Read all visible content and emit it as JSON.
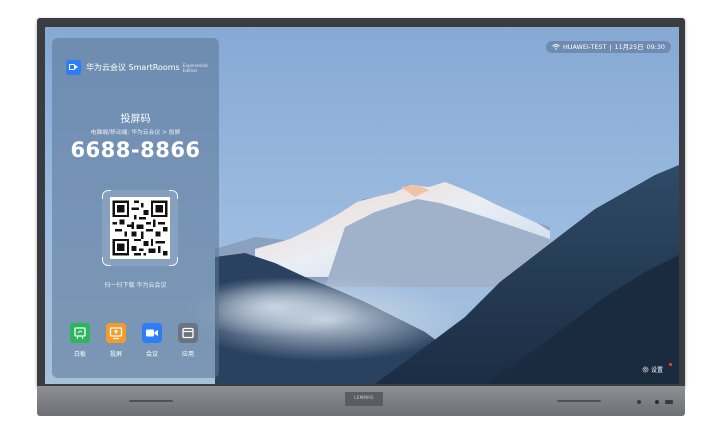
{
  "status": {
    "network": "HUAWEI-TEST",
    "date": "11月25日",
    "time": "09:30"
  },
  "brand": {
    "name": "华为云会议 SmartRooms",
    "edition": "Experiential Edition"
  },
  "share": {
    "title": "投屏码",
    "subtitle": "电脑端/移动端: 华为云会议 > 投屏",
    "code": "6688-8866"
  },
  "qr": {
    "caption": "扫一扫下载 华为云会议"
  },
  "apps": [
    {
      "label": "白板",
      "icon": "whiteboard-icon",
      "color": "#2db55d"
    },
    {
      "label": "投屏",
      "icon": "screen-share-icon",
      "color": "#f39c2c"
    },
    {
      "label": "会议",
      "icon": "video-meeting-icon",
      "color": "#2c7df7"
    },
    {
      "label": "应用",
      "icon": "apps-icon",
      "color": "#6c7482"
    }
  ],
  "settings": {
    "label": "设置"
  },
  "device": {
    "logo": "LEMMRO"
  }
}
